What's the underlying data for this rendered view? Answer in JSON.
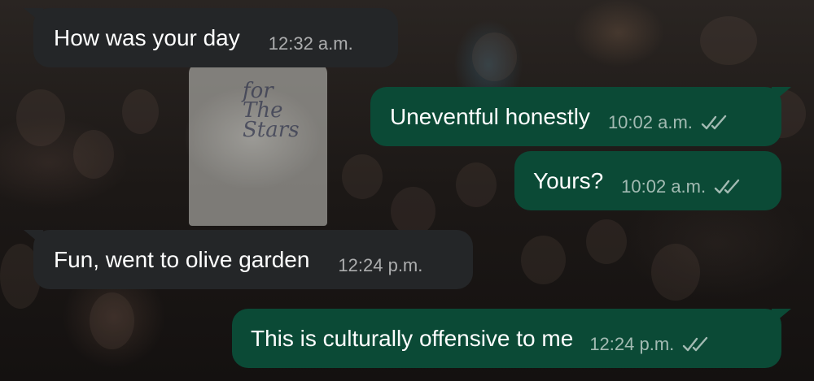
{
  "conversation": {
    "messages": [
      {
        "direction": "incoming",
        "text": "How was your day",
        "time": "12:32 a.m."
      },
      {
        "direction": "outgoing",
        "text": "Uneventful honestly",
        "time": "10:02 a.m.",
        "status": "read-double-check-icon"
      },
      {
        "direction": "outgoing",
        "text": "Yours?",
        "time": "10:02 a.m.",
        "status": "read-double-check-icon"
      },
      {
        "direction": "incoming",
        "text": "Fun, went to olive garden",
        "time": "12:24 p.m."
      },
      {
        "direction": "outgoing",
        "text": "This is culturally offensive to me",
        "time": "12:24 p.m.",
        "status": "read-double-check-icon"
      }
    ]
  },
  "wallpaper": {
    "shirt_text": "for The Stars"
  },
  "colors": {
    "incoming_bubble": "#242628",
    "outgoing_bubble": "#0b4a36",
    "text": "#ffffff",
    "meta_text": "#a8aeab"
  }
}
